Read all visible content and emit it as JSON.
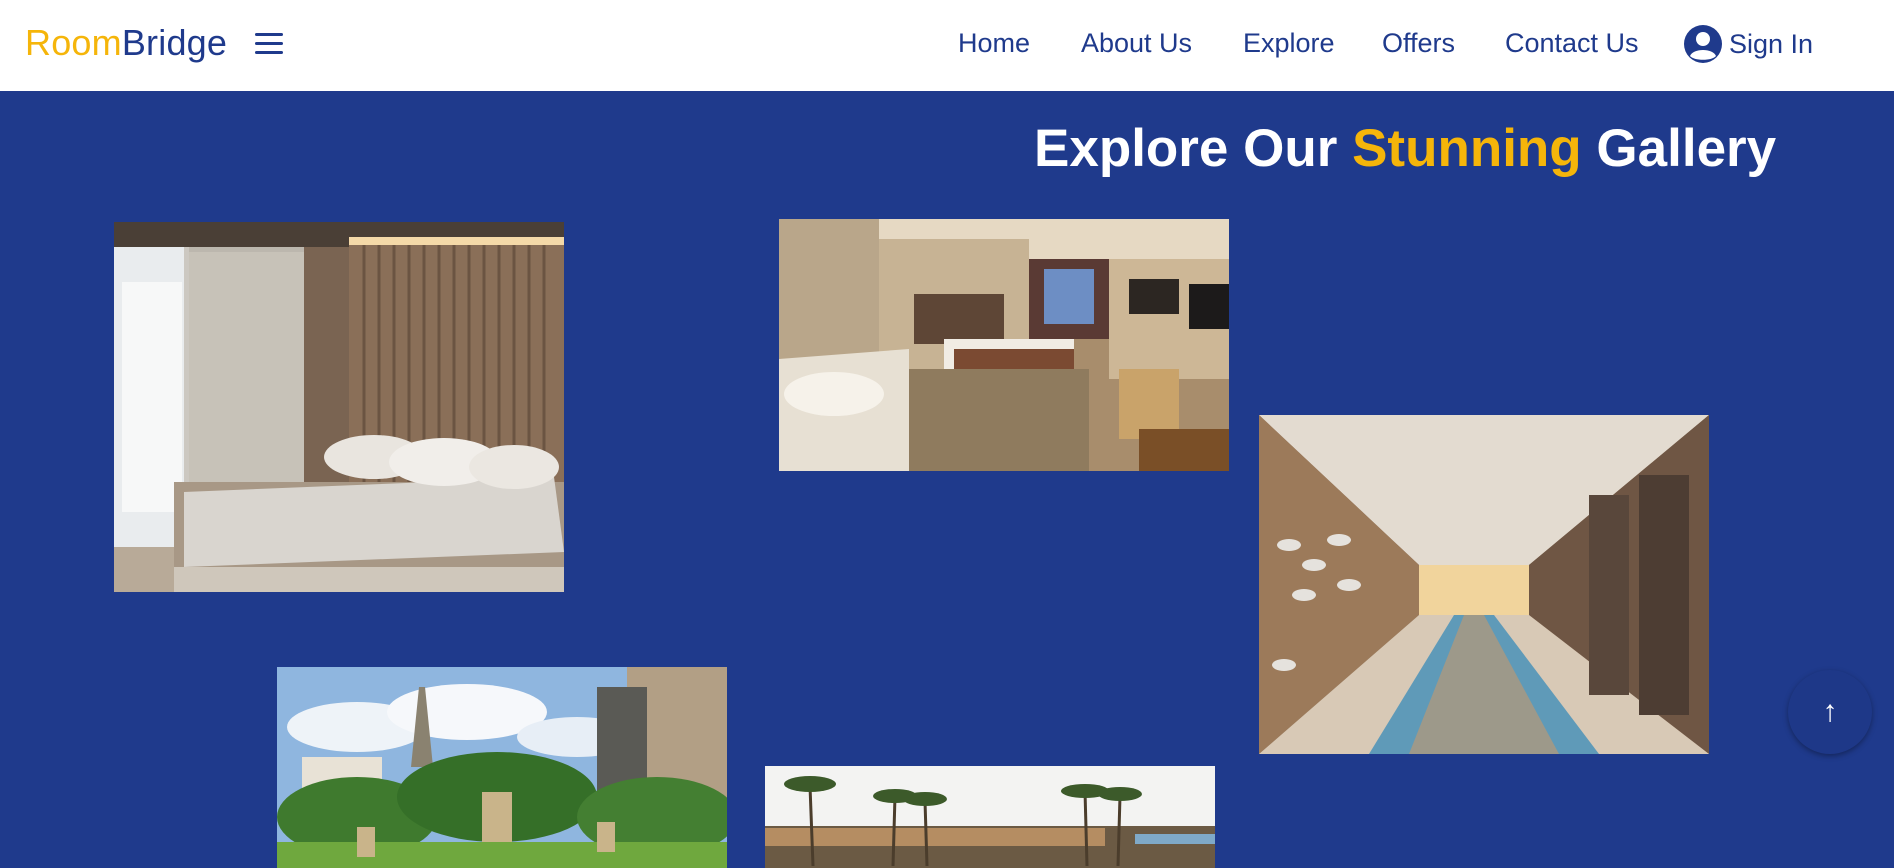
{
  "brand": {
    "part1": "Room",
    "part2": "Bridge"
  },
  "nav": {
    "home": "Home",
    "about": "About Us",
    "explore": "Explore",
    "offers": "Offers",
    "contact": "Contact Us",
    "signin": "Sign In"
  },
  "gallery": {
    "title_before": "Explore Our ",
    "title_highlight": "Stunning",
    "title_after": " Gallery"
  },
  "scroll_top": {
    "glyph": "↑"
  },
  "colors": {
    "primary": "#1f3a8c",
    "accent": "#f5b50a",
    "navbar_bg": "#ffffff"
  },
  "icons": {
    "menu": "hamburger-icon",
    "user": "user-circle-icon",
    "scroll_top": "arrow-up-icon"
  }
}
